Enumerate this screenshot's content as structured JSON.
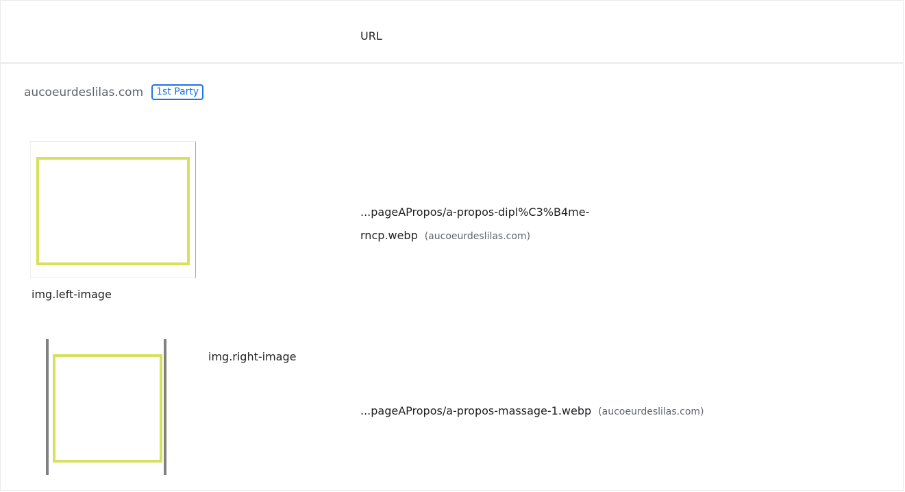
{
  "header": {
    "url_label": "URL"
  },
  "group": {
    "origin": "aucoeurdeslilas.com",
    "badge": "1st Party"
  },
  "items": [
    {
      "selector": "img.left-image",
      "url_line1": "...pageAPropos/a-propos-dipl%C3%B4me-",
      "url_line2": "rncp.webp",
      "domain": "(aucoeurdeslilas.com)"
    },
    {
      "selector": "img.right-image",
      "url": "...pageAPropos/a-propos-massage-1.webp",
      "domain": "(aucoeurdeslilas.com)"
    }
  ],
  "colors": {
    "accent": "#1a73e8",
    "thumbnail_frame": "#d7e05d",
    "border": "#e8eaed"
  }
}
